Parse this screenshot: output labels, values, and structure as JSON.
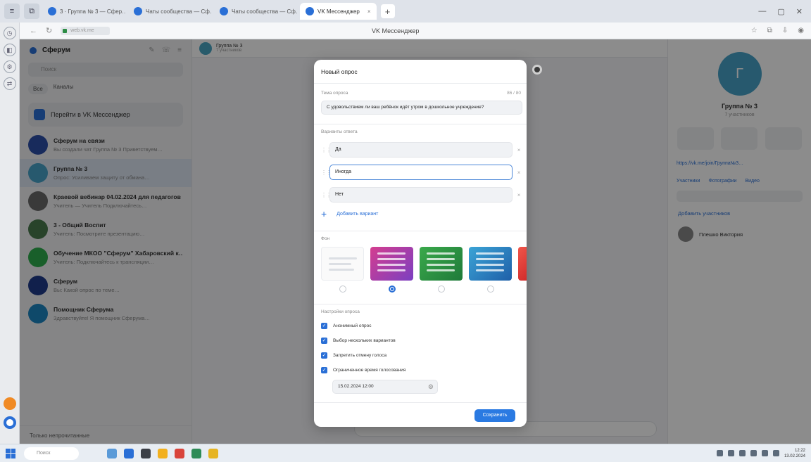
{
  "browser": {
    "tabs": [
      {
        "label": "3 · Группа № 3 — Сфер…"
      },
      {
        "label": "Чаты сообщества — Сф…"
      },
      {
        "label": "Чаты сообщества — Сф…"
      },
      {
        "label": "VK Мессенджер"
      }
    ],
    "window_title": "VK Мессенджер",
    "url_text": "web.vk.me"
  },
  "sidebar": {
    "title": "Сферум",
    "search_placeholder": "Поиск",
    "filters": [
      "Все",
      "Каналы"
    ],
    "promo": "Перейти в VK Мессенджер",
    "chats": [
      {
        "name": "Сферум на связи",
        "preview": "Вы создали чат Группа № 3 Приветствуем…",
        "color": "#2d4fa8"
      },
      {
        "name": "Группа № 3",
        "preview": "Опрос: Усиливаем защиту от обмана…",
        "color": "#47a3c8"
      },
      {
        "name": "Краевой вебинар 04.02.2024 для педагогов",
        "preview": "Учитель — Учитель Подключайтесь…",
        "color": "#6a6a6a"
      },
      {
        "name": "3 - Общий Воспит",
        "preview": "Учитель: Посмотрите презентацию…",
        "color": "#4a7a4e"
      },
      {
        "name": "Обучение МКОО \"Сферум\" Хабаровский к…",
        "preview": "Учитель: Подключайтесь к трансляции…",
        "color": "#2fae4d"
      },
      {
        "name": "Сферум",
        "preview": "Вы: Какой опрос по теме…",
        "color": "#1f3b8a"
      },
      {
        "name": "Помощник Сферума",
        "preview": "Здравствуйте! Я помощник Сферума…",
        "color": "#1d86c2"
      }
    ],
    "bottom": "Только непрочитанные"
  },
  "chat_header": {
    "name": "Группа № 3",
    "sub": "7 участников"
  },
  "right_panel": {
    "avatar_letter": "Г",
    "name": "Группа № 3",
    "sub": "7 участников",
    "link": "https://vk.me/join/Группа№3…",
    "tabs": [
      "Участники",
      "Фотографии",
      "Видео"
    ],
    "add_member": "Добавить участников",
    "member": "Плешко Виктория"
  },
  "modal": {
    "title": "Новый опрос",
    "question_label": "Тема опроса",
    "question_counter": "86 / 80",
    "question_value": "С удовольствием ли ваш ребёнок идёт утром в дошкольное учреждение?",
    "options_label": "Варианты ответа",
    "options": [
      "Да",
      "Иногда",
      "Нет"
    ],
    "add_option": "Добавить вариант",
    "background_label": "Фон",
    "selected_background": 1,
    "settings_label": "Настройки опроса",
    "checkboxes": [
      {
        "label": "Анонимный опрос",
        "checked": true
      },
      {
        "label": "Выбор нескольких вариантов",
        "checked": true
      },
      {
        "label": "Запретить отмену голоса",
        "checked": true
      },
      {
        "label": "Ограниченное время голосования",
        "checked": true
      }
    ],
    "end_date": "15.02.2024 12:00",
    "save": "Сохранить"
  },
  "taskbar": {
    "search_placeholder": "Поиск",
    "time": "12:22",
    "date": "13.02.2024"
  }
}
